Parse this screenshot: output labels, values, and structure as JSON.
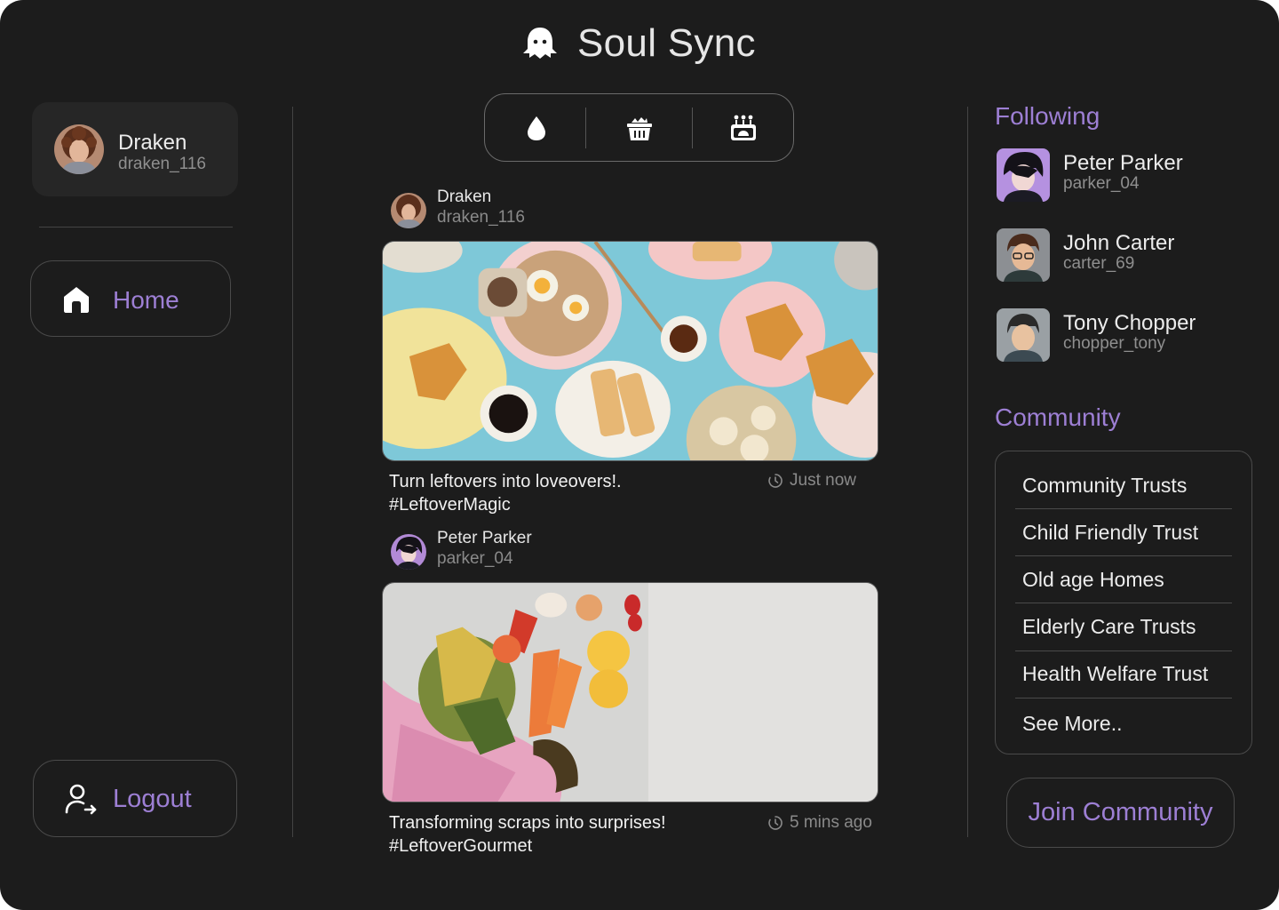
{
  "app": {
    "name": "Soul Sync"
  },
  "user": {
    "name": "Draken",
    "username": "draken_116"
  },
  "nav": {
    "home_label": "Home",
    "logout_label": "Logout"
  },
  "tabs": [
    {
      "icon": "water-drop-icon"
    },
    {
      "icon": "food-basket-icon"
    },
    {
      "icon": "food-donation-icon"
    }
  ],
  "posts": [
    {
      "author_name": "Draken",
      "author_username": "draken_116",
      "caption_line1": "Turn leftovers into loveovers!.",
      "caption_line2": "#LeftoverMagic",
      "time": "Just now"
    },
    {
      "author_name": "Peter Parker",
      "author_username": "parker_04",
      "caption_line1": "Transforming scraps into surprises!",
      "caption_line2": "#LeftoverGourmet",
      "time": "5 mins ago"
    }
  ],
  "following": {
    "title": "Following",
    "items": [
      {
        "name": "Peter Parker",
        "username": "parker_04"
      },
      {
        "name": "John Carter",
        "username": "carter_69"
      },
      {
        "name": "Tony Chopper",
        "username": "chopper_tony"
      }
    ]
  },
  "community": {
    "title": "Community",
    "items": [
      "Community Trusts",
      "Child Friendly Trust",
      "Old age Homes",
      "Elderly Care Trusts",
      "Health Welfare Trust",
      "See More.."
    ],
    "join_label": "Join Community"
  },
  "colors": {
    "background": "#1c1c1c",
    "accent": "#9d7fd4",
    "card": "#262626"
  }
}
